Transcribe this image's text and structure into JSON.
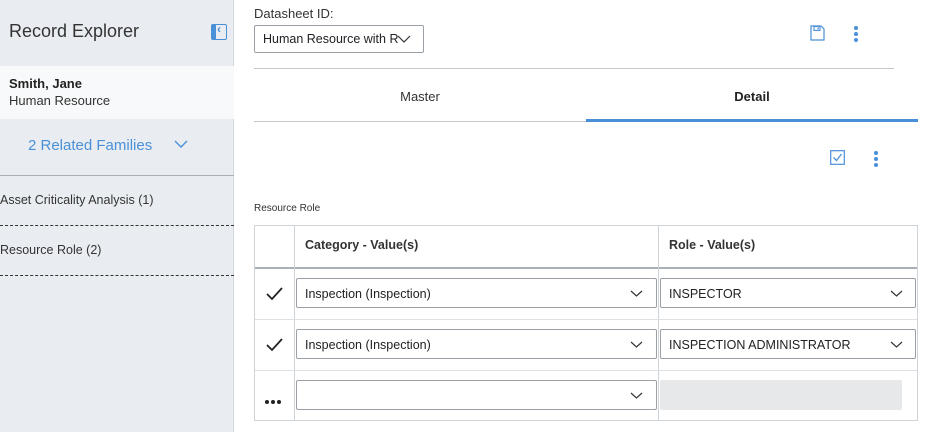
{
  "sidebar": {
    "title": "Record Explorer",
    "record": {
      "name": "Smith, Jane",
      "family": "Human Resource"
    },
    "related_label": "2 Related Families",
    "families": [
      {
        "label": "Asset Criticality Analysis (1)"
      },
      {
        "label": "Resource Role (2)"
      }
    ]
  },
  "datasheet": {
    "label": "Datasheet ID:",
    "selected": "Human Resource with R"
  },
  "tabs": [
    {
      "label": "Master",
      "active": false
    },
    {
      "label": "Detail",
      "active": true
    }
  ],
  "grid": {
    "caption": "Resource Role",
    "columns": [
      "Category - Value(s)",
      "Role - Value(s)"
    ],
    "rows": [
      {
        "category": "Inspection (Inspection)",
        "role": "INSPECTOR"
      },
      {
        "category": "Inspection (Inspection)",
        "role": "INSPECTION ADMINISTRATOR"
      },
      {
        "category": "",
        "role": ""
      }
    ]
  },
  "colors": {
    "accent": "#4a90d9",
    "sidebar_bg": "#e9edf1"
  },
  "icons": [
    "sidebar-collapse-icon",
    "chevron-down-icon",
    "save-icon",
    "kebab-menu-icon",
    "checkbox-icon",
    "checkmark-icon",
    "ellipsis-icon"
  ]
}
